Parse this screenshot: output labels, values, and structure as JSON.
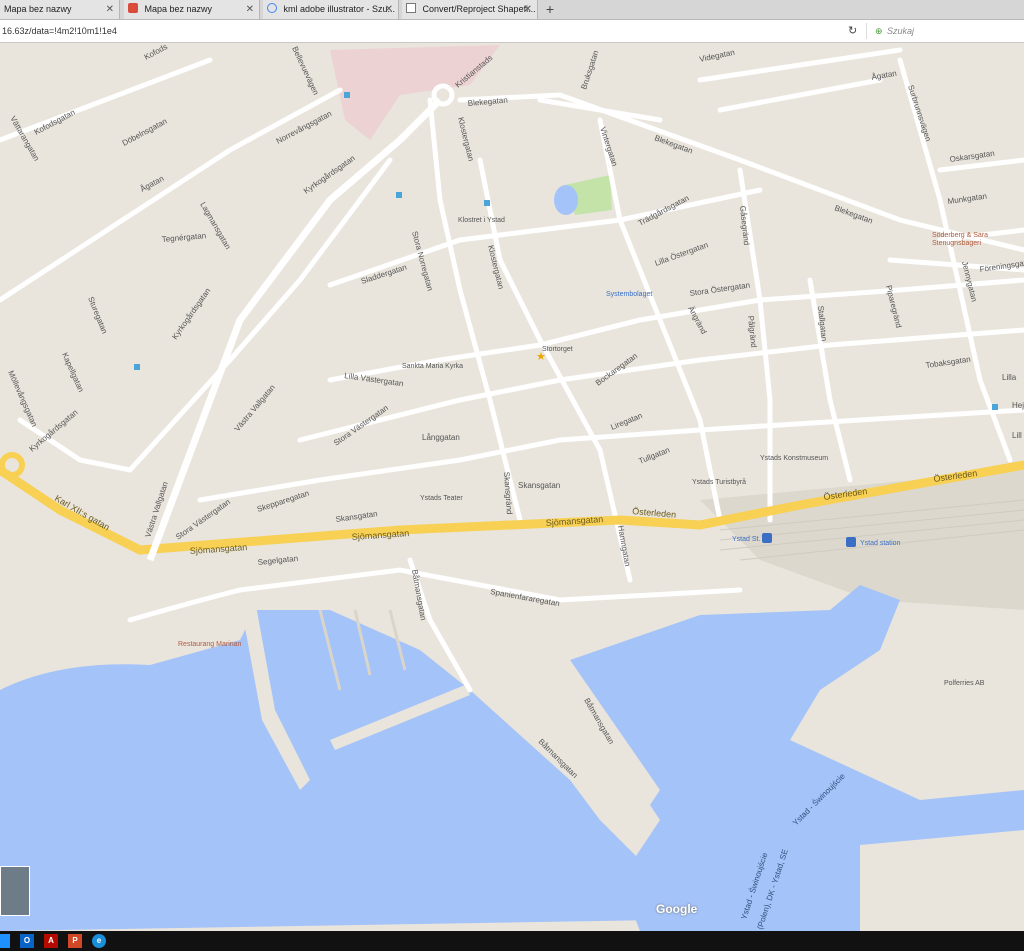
{
  "browser": {
    "tabs": [
      {
        "label": "Mapa bez nazwy",
        "icon": "blank-page-icon"
      },
      {
        "label": "Mapa bez nazwy",
        "icon": "maps-pin-icon"
      },
      {
        "label": "kml adobe illustrator - Szu...",
        "icon": "google-g-icon"
      },
      {
        "label": "Convert/Reproject Shapefi...",
        "icon": "page-icon"
      }
    ],
    "close_glyph": "✕",
    "new_tab_glyph": "+",
    "url": "16.63z/data=!4m2!10m1!1e4",
    "reload_glyph": "↻",
    "search_placeholder": "Szukaj"
  },
  "map": {
    "streets": {
      "kristianstads": "Kristianstads",
      "videgatan": "Videgatan",
      "kofodsgatan": "Kofodsgatan",
      "kofods": "Kofods",
      "ellevuevagen": "Bellevuevägen",
      "bruksgatan": "Bruksgatan",
      "agatan_n": "Ågatan",
      "surbrunnsvagen": "Surbrunnsvägen",
      "blekegatan_w": "Blekegatan",
      "blekegatan_c": "Blekegatan",
      "blekegatan_e": "Blekegatan",
      "vattarangatan": "Vättarangatan",
      "dobelnsgatan": "Döbelnsgatan",
      "norrevangsgatan": "Norrevångsgatan",
      "klostergatan": "Klostergatan",
      "vintergatan": "Vintergatan",
      "oskarsgatan": "Oskarsgatan",
      "kyrkogardsgatan_n": "Kyrkogårdsgatan",
      "agatan_w": "Ågatan",
      "munkgatan": "Munkgatan",
      "lagmansgatan": "Lagmansgatan",
      "tradgardsgatan": "Trädgårdsgatan",
      "gasegrand": "Gåsegränd",
      "tegnergatan": "Tegnérgatan",
      "stora_norregatan": "Stora Norregatan",
      "klostergatan_s": "Klostergatan",
      "lilla_ostergatan": "Lilla Östergatan",
      "jennygatan": "Jennygatan",
      "foreningsgatan": "Föreningsgat",
      "sladdergatan": "Sladdergatan",
      "stora_ostergatan": "Stora Östergatan",
      "piparegrand": "Piparegränd",
      "sturegatan": "Sturegatan",
      "kyrkogardsgatan_m": "Kyrkogårdsgatan",
      "angrand": "Ängränd",
      "palgrand": "Pålgränd",
      "stallgatan": "Stallgatan",
      "kapellgatan": "Kapellgatan",
      "mollevangsgatan": "Möllevångsgatan",
      "bockaregatan": "Bockaregatan",
      "tobaksgatan": "Tobaksgatan",
      "lilla_vastergatan": "Lilla Västergatan",
      "lilla_e": "Lilla",
      "lilla_e2": "Lill",
      "hej": "Hej",
      "vastra_vallgatan": "Västra Vallgatan",
      "kyrkogardsgatan_s": "Kyrkogårdsgatan",
      "stora_vastergatan": "Stora Västergatan",
      "liregatan": "Liregatan",
      "langgatan": "Långgatan",
      "tullgatan": "Tullgatan",
      "skansgatan_e": "Skansgatan",
      "skansgrand": "Skansgränd",
      "osterleden_e": "Österleden",
      "osterleden_e2": "Österleden",
      "karl_xii": "Karl XII:s gatan",
      "vastra_vallgatan_s": "Västra Vallgatan",
      "skepparegatan": "Skepparegatan",
      "stora_vastergatan_s": "Stora Västergatan",
      "skansgatan_w": "Skansgatan",
      "osterleden_c": "Österleden",
      "sjomansgatan_c": "Sjömansgatan",
      "hamngatan": "Hamngatan",
      "sjomansgatan_m": "Sjömansgatan",
      "sjomansgatan_w": "Sjömansgatan",
      "segelgatan": "Segelgatan",
      "batmansgatan_n": "Båtmansgatan",
      "spanienfararegatan": "Spanienfararegatan",
      "batmansgatan_c": "Båtmansgatan",
      "batmansgatan_s": "Båtmansgatan"
    },
    "pois": {
      "klostret": "Klostret i Ystad",
      "soderberg": "Söderberg & Sara",
      "stenugnsbageri": "Stenugnsbageri",
      "systembolaget": "Systembolaget",
      "stortorget": "Stortorget",
      "sankta_maria": "Sankta Maria Kyrka",
      "konstmuseum": "Ystads Konstmuseum",
      "turistbyra": "Ystads Turistbyrå",
      "teater": "Ystads Teater",
      "ystad_st": "Ystad St.",
      "ystad_station": "Ystad station",
      "restaurang": "Restaurang Marinan",
      "polferries": "Polferries AB"
    },
    "ferry_routes": {
      "route1": "Ystad - Świnoujście",
      "route2": "Ystad - Świnoujście",
      "route3": "(Polen), DK - Ystad, SE"
    },
    "attribution": "Google",
    "colors": {
      "land": "#e9e5dc",
      "road": "#ffffff",
      "highway": "#f7d054",
      "water": "#a4c3f8",
      "park": "#c3e3a9",
      "hospital": "#ecd2d2",
      "port": "#d9d5cb"
    }
  },
  "taskbar": {
    "items": [
      {
        "label": "",
        "icon": "windows-start-icon"
      },
      {
        "label": "O",
        "icon": "outlook-icon"
      },
      {
        "label": "A",
        "icon": "acrobat-icon"
      },
      {
        "label": "P",
        "icon": "powerpoint-icon"
      },
      {
        "label": "e",
        "icon": "internet-explorer-icon"
      }
    ]
  }
}
